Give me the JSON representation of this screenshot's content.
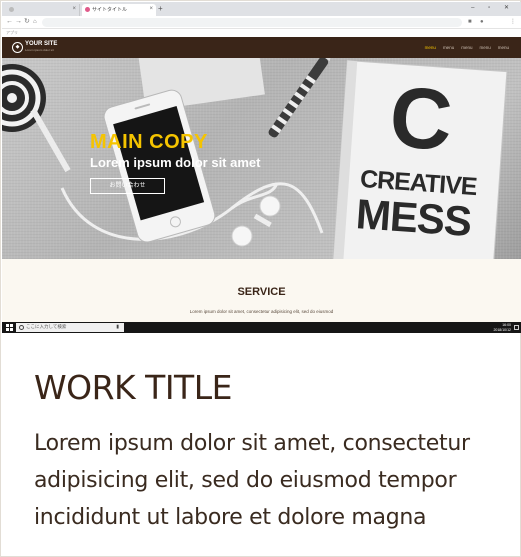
{
  "browser": {
    "tabs": [
      {
        "label": "",
        "active": false
      },
      {
        "label": "サイトタイトル",
        "active": true
      }
    ],
    "new_tab_symbol": "+",
    "window_controls": "– ▫ ✕",
    "address": "",
    "bookmark_label": "アプリ"
  },
  "site": {
    "logo_text": "YOUR SITE",
    "logo_tagline": "Lorem ipsum dolor sit",
    "nav": [
      "menu",
      "menu",
      "menu",
      "menu",
      "menu"
    ],
    "nav_current_index": 0,
    "accent_color": "#f5c400",
    "header_color": "#3a2518"
  },
  "hero": {
    "title": "MAIN COPY",
    "subtitle": "Lorem ipsum dolor sit amet",
    "button_label": "お問い合わせ",
    "notebook_letter": "C",
    "notebook_line1": "CREATIVE",
    "notebook_line2": "MESS"
  },
  "service": {
    "title": "SERVICE",
    "text": "Lorem ipsum dolor sit amet, consectetur adipisicing elit, sed do eiusmod"
  },
  "taskbar": {
    "search_placeholder": "ここに入力して検索",
    "clock_time": "16:00",
    "clock_date": "2018/10/12"
  },
  "work": {
    "title": "WORK TITLE",
    "description": "Lorem ipsum dolor sit amet, consectetur adipisicing elit, sed do eiusmod tempor incididunt ut labore et dolore magna"
  }
}
